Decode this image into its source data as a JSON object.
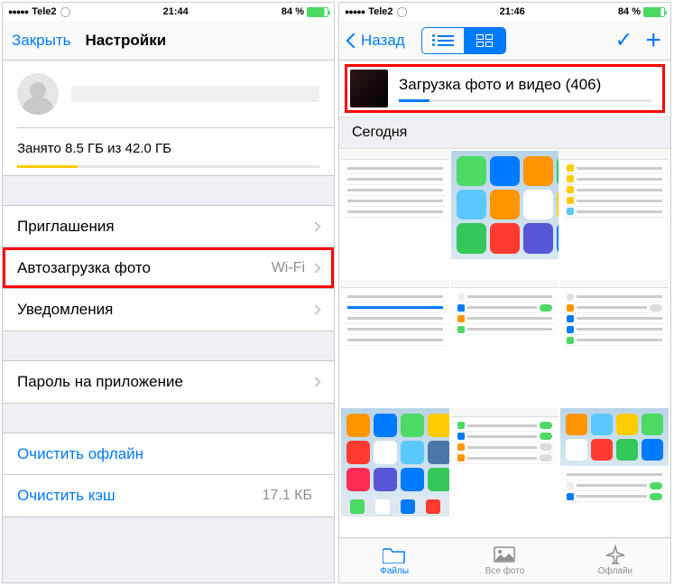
{
  "left": {
    "status": {
      "carrier": "Tele2",
      "time": "21:44",
      "battery": "84 %"
    },
    "nav": {
      "close": "Закрыть",
      "title": "Настройки"
    },
    "storage": "Занято 8.5 ГБ из 42.0 ГБ",
    "rows": {
      "invitations": "Приглашения",
      "autoupload": "Автозагрузка фото",
      "autoupload_value": "Wi-Fi",
      "notifications": "Уведомления",
      "app_password": "Пароль на приложение",
      "clear_offline": "Очистить офлайн",
      "clear_cache": "Очистить кэш",
      "clear_cache_value": "17.1 КБ"
    }
  },
  "right": {
    "status": {
      "carrier": "Tele2",
      "time": "21:46",
      "battery": "84 %"
    },
    "nav": {
      "back": "Назад"
    },
    "upload": "Загрузка фото и видео (406)",
    "section": "Сегодня",
    "tabs": {
      "files": "Файлы",
      "all_photos": "Все фото",
      "offline": "Офлайн"
    }
  }
}
